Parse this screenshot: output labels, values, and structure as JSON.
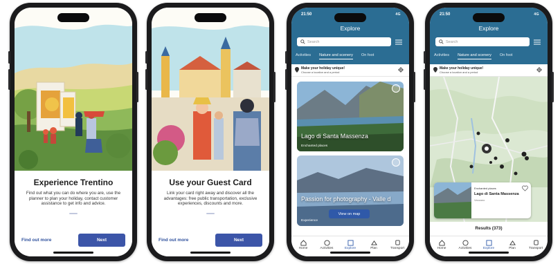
{
  "phones": {
    "p1": {
      "title": "Experience Trentino",
      "text": "Find out what you can do where you are, use the planner to plan your holiday, contact customer assistance to get info and advice.",
      "link": "Find out more",
      "next": "Next"
    },
    "p2": {
      "title": "Use your Guest Card",
      "text": "Link your card right away and discover all the advantages: free public transportation, exclusive experiences, discounts and more.",
      "link": "Find out more",
      "next": "Next"
    },
    "p3": {
      "time": "21:50",
      "signal": "4G",
      "title": "Explore",
      "search_placeholder": "Search",
      "tabs": [
        "Activities",
        "Nature and scenery",
        "On foot"
      ],
      "location_title": "Make your holiday unique!",
      "location_sub": "Choose a location and a period",
      "cards": [
        {
          "title": "Lago di Santa Massenza",
          "sub": "Enchanted places"
        },
        {
          "title": "Passion for photography - Valle d",
          "sub": "Experience",
          "map_button": "View on map"
        }
      ]
    },
    "p4": {
      "time": "21:50",
      "signal": "4G",
      "title": "Explore",
      "search_placeholder": "Search",
      "tabs": [
        "Activities",
        "Nature and scenery",
        "On foot"
      ],
      "location_title": "Make your holiday unique!",
      "location_sub": "Choose a location and a period",
      "poi": {
        "category": "Enchanted places",
        "name": "Lago di Santa Massenza",
        "location": "Vezzano"
      },
      "results": "Results (373)"
    }
  },
  "tabbar": [
    "Home",
    "Activities",
    "Explore",
    "Plan",
    "Transport"
  ],
  "colors": {
    "primary": "#2b6d93",
    "button": "#3c55a8",
    "accent": "#2f59a9"
  }
}
